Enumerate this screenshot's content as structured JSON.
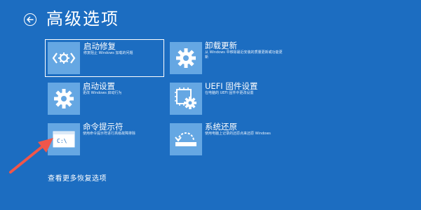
{
  "header": {
    "title": "高级选项",
    "back_icon": "back-arrow-icon"
  },
  "tiles": [
    {
      "icon": "code-brackets-icon",
      "title": "启动修复",
      "desc": "修复阻止 Windows 加载的问题"
    },
    {
      "icon": "gear-icon",
      "title": "卸载更新",
      "desc": "从 Windows 中移除最近安装的质量更新或功能更新"
    },
    {
      "icon": "gear-icon",
      "title": "启动设置",
      "desc": "更改 Windows 启动行为"
    },
    {
      "icon": "firmware-chip-gear-icon",
      "title": "UEFI 固件设置",
      "desc": "在电脑的 UEFI 固件中更改设置"
    },
    {
      "icon": "command-prompt-icon",
      "title": "命令提示符",
      "desc": "使用命令提示符进行高级故障排除",
      "icon_text": "C:\\"
    },
    {
      "icon": "system-restore-icon",
      "title": "系统还原",
      "desc": "使用电脑上记录的还原点来还原 Windows"
    }
  ],
  "footer": {
    "more_link": "查看更多恢复选项"
  },
  "annotation": {
    "arrow_color": "#f0564a"
  },
  "colors": {
    "background": "#1c6dc1",
    "icon_tile": "#65a7e3"
  }
}
